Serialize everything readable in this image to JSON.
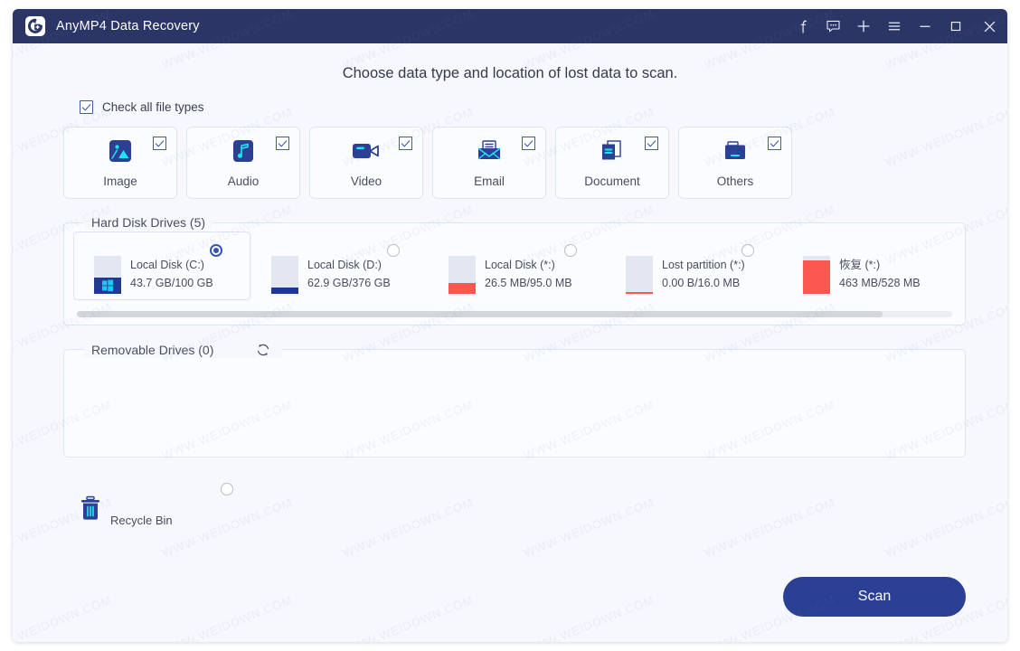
{
  "window": {
    "title": "AnyMP4 Data Recovery",
    "logo_icon": "recovery-logo-icon",
    "controls": [
      {
        "name": "facebook-icon",
        "glyph": "f"
      },
      {
        "name": "feedback-icon",
        "glyph": "chat"
      },
      {
        "name": "plus-icon",
        "glyph": "+"
      },
      {
        "name": "menu-icon",
        "glyph": "hamburger"
      },
      {
        "name": "minimize-icon",
        "glyph": "−"
      },
      {
        "name": "maximize-icon",
        "glyph": "□"
      },
      {
        "name": "close-icon",
        "glyph": "✕"
      }
    ]
  },
  "headline": "Choose data type and location of lost data to scan.",
  "check_all": {
    "label": "Check all file types",
    "checked": true
  },
  "file_types": [
    {
      "label": "Image",
      "icon": "image-icon",
      "checked": true
    },
    {
      "label": "Audio",
      "icon": "audio-icon",
      "checked": true
    },
    {
      "label": "Video",
      "icon": "video-icon",
      "checked": true
    },
    {
      "label": "Email",
      "icon": "email-icon",
      "checked": true
    },
    {
      "label": "Document",
      "icon": "document-icon",
      "checked": true
    },
    {
      "label": "Others",
      "icon": "others-icon",
      "checked": true
    }
  ],
  "hard_disk_drives": {
    "legend": "Hard Disk Drives (5)",
    "items": [
      {
        "name": "Local Disk (C:)",
        "size": "43.7 GB/100 GB",
        "selected": true,
        "fill_pct": 44,
        "fill_color": "#1f3a93",
        "badge": "windows-logo"
      },
      {
        "name": "Local Disk (D:)",
        "size": "62.9 GB/376 GB",
        "selected": false,
        "fill_pct": 17,
        "fill_color": "#1f3a93",
        "badge": ""
      },
      {
        "name": "Local Disk (*:)",
        "size": "26.5 MB/95.0 MB",
        "selected": false,
        "fill_pct": 28,
        "fill_color": "#f9574f",
        "badge": ""
      },
      {
        "name": "Lost partition (*:)",
        "size": "0.00  B/16.0 MB",
        "selected": false,
        "fill_pct": 4,
        "fill_color": "#f9574f",
        "badge": ""
      },
      {
        "name": "恢复 (*:)",
        "size": "463 MB/528 MB",
        "selected": false,
        "fill_pct": 88,
        "fill_color": "#f9574f",
        "badge": ""
      }
    ],
    "scrollbar_thumb_pct": 92
  },
  "removable_drives": {
    "legend": "Removable Drives (0)",
    "refresh_icon": "refresh-icon",
    "items": []
  },
  "recycle_bin": {
    "label": "Recycle Bin",
    "icon": "trash-icon",
    "selected": false
  },
  "scan_button": {
    "label": "Scan"
  },
  "colors": {
    "titlebar": "#2b3566",
    "accent": "#2b3f94",
    "icon_cyan": "#1fe3f0",
    "page_bg": "#f6f8fd"
  },
  "watermark_text": "WWW.WEIDOWN.COM"
}
